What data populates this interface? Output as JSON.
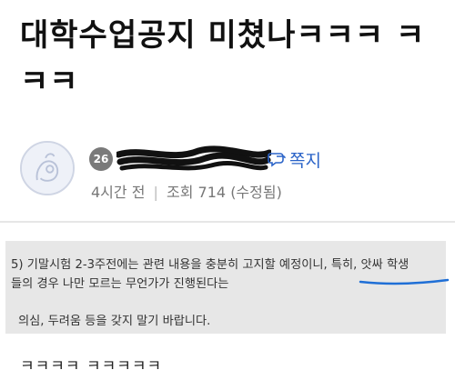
{
  "post": {
    "title": "대학수업공지 미쳤나ㅋㅋㅋ ㅋㅋㅋ"
  },
  "author": {
    "level": "26",
    "nickname": "",
    "message_label": "쪽지",
    "time_ago": "4시간 전",
    "views_label": "조회 714",
    "edited_label": "(수정됨)"
  },
  "notice": {
    "line1": "5) 기말시험 2-3주전에는 관련 내용을 충분히 고지할 예정이니, 특히, 앗싸 학생",
    "line2": "들의 경우 나만 모르는 무언가가 진행된다는",
    "line3": "의심, 두려움 등을 갖지 말기 바랍니다."
  },
  "comment": {
    "text": "ㅋㅋㅋㅋ ㅋㅋㅋㅋㅋ"
  },
  "colors": {
    "accent": "#2a63c8",
    "underline": "#1f6fd6",
    "notice_bg": "#e7e7e7",
    "redaction": "#111111"
  },
  "icons": {
    "message": "chat-bubble-icon",
    "avatar": "avatar-illustration"
  }
}
